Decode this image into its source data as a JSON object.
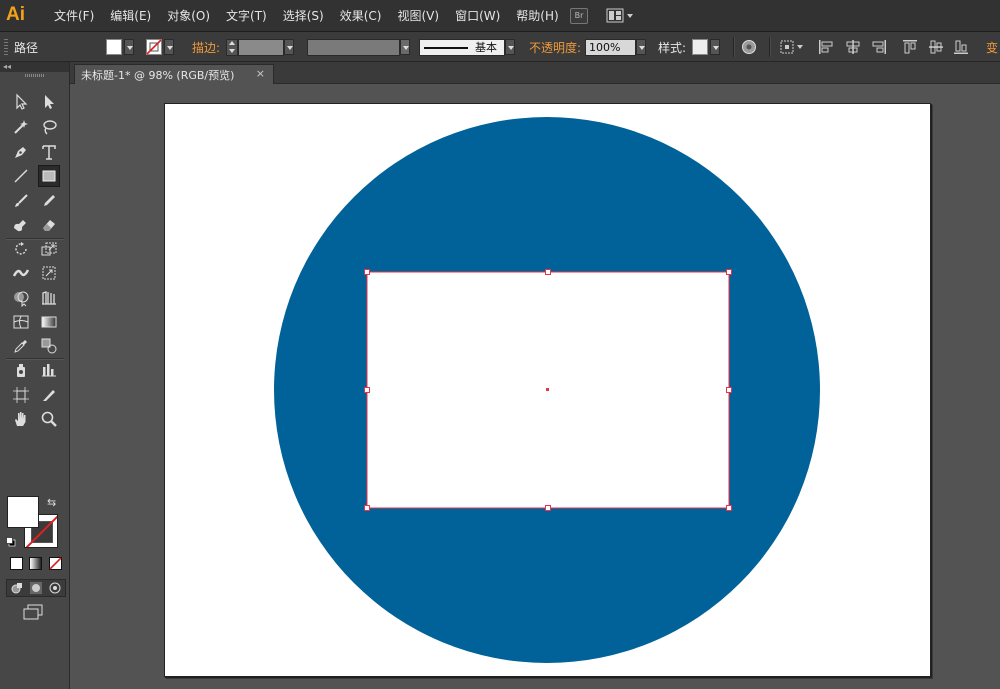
{
  "app": {
    "logo_text": "Ai"
  },
  "menu": [
    "文件(F)",
    "编辑(E)",
    "对象(O)",
    "文字(T)",
    "选择(S)",
    "效果(C)",
    "视图(V)",
    "窗口(W)",
    "帮助(H)"
  ],
  "menubar_buttons": {
    "bridge": "Br"
  },
  "control": {
    "selection_type": "路径",
    "stroke_label": "描边:",
    "stroke_profile": "基本",
    "opacity_label": "不透明度:",
    "opacity_value": "100%",
    "style_label": "样式:",
    "trailing_label": "变"
  },
  "document": {
    "tab_title": "未标题-1* @ 98% (RGB/预览)",
    "close": "×"
  },
  "tools": [
    "selection",
    "direct-selection",
    "magic-wand",
    "lasso",
    "pen",
    "type",
    "line-segment",
    "rectangle",
    "paintbrush",
    "pencil",
    "blob-brush",
    "eraser",
    "rotate",
    "scale",
    "width",
    "free-transform",
    "shape-builder",
    "perspective-grid",
    "mesh",
    "gradient",
    "eyedropper",
    "blend",
    "symbol-sprayer",
    "column-graph",
    "artboard",
    "slice",
    "hand",
    "zoom"
  ],
  "active_tool": "rectangle",
  "colors": {
    "circle_fill": "#006298",
    "rect_fill": "#ffffff",
    "selection": "#e8334a",
    "fill_swatch": "#ffffff",
    "ui_dark": "#323232",
    "ui_panel": "#474747",
    "canvas": "#535353",
    "accent_orange": "#f09a3a"
  }
}
